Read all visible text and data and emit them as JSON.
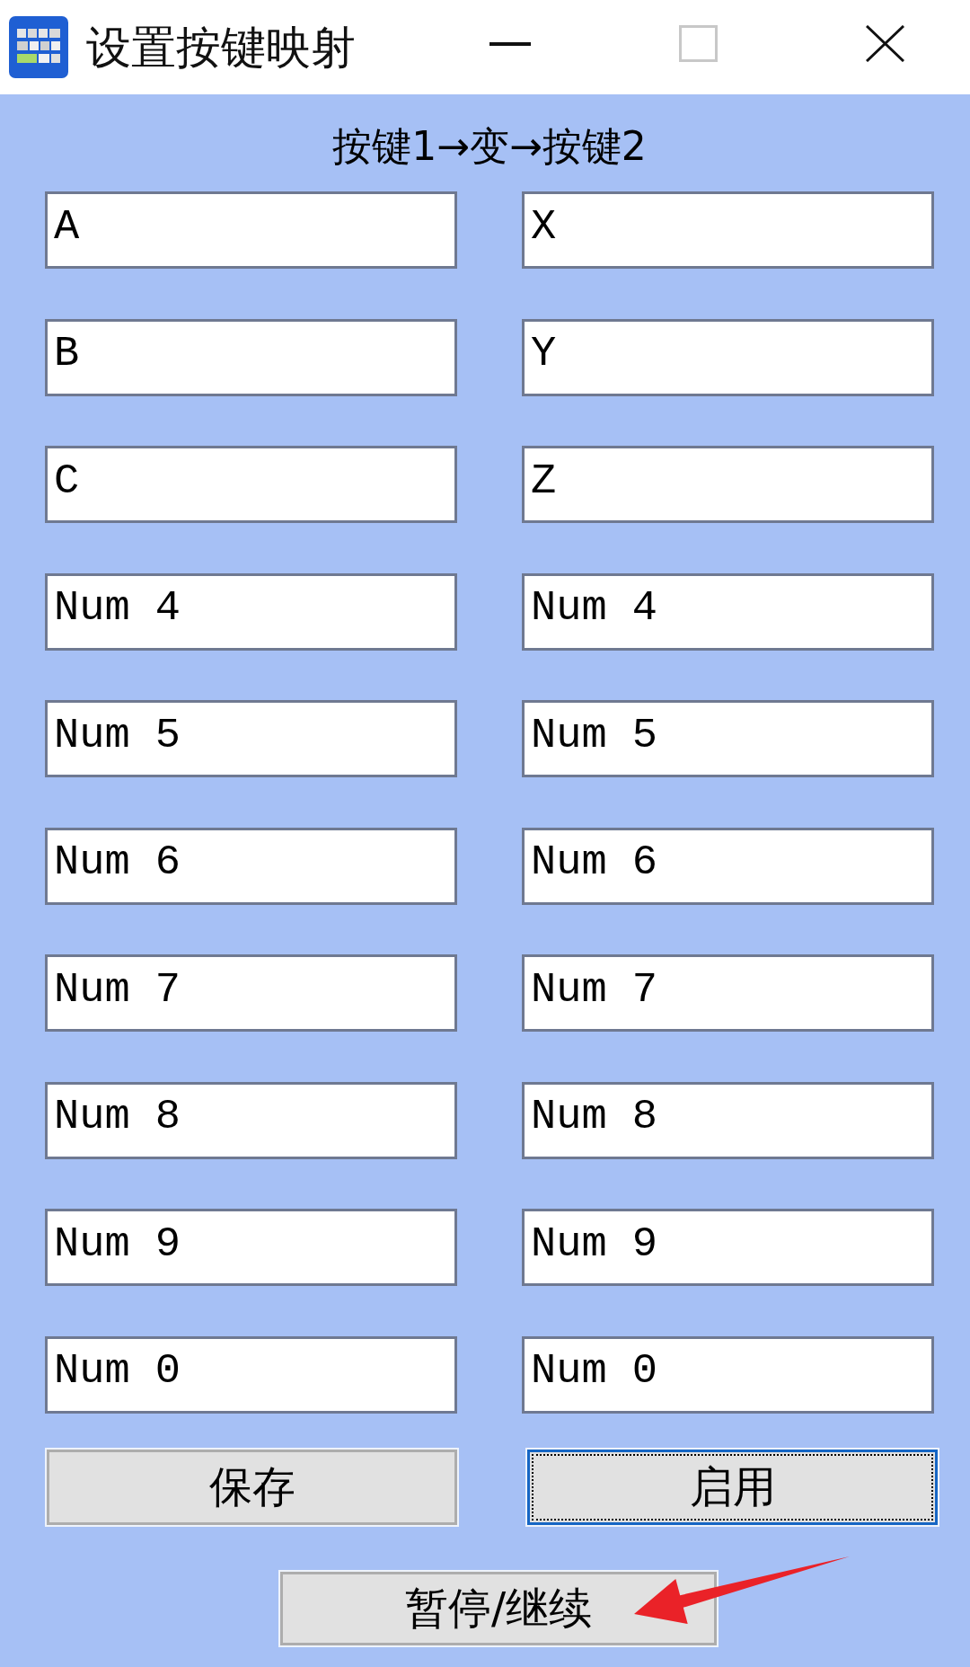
{
  "window": {
    "title": "设置按键映射",
    "controls": [
      {
        "kind": "minimize",
        "disabled": false
      },
      {
        "kind": "maximize",
        "disabled": true
      },
      {
        "kind": "close",
        "disabled": false
      }
    ]
  },
  "header": "按键1→变→按键2",
  "mappings": [
    {
      "from": "A",
      "to": "X"
    },
    {
      "from": "B",
      "to": "Y"
    },
    {
      "from": "C",
      "to": "Z"
    },
    {
      "from": "Num 4",
      "to": "Num 4"
    },
    {
      "from": "Num 5",
      "to": "Num 5"
    },
    {
      "from": "Num 6",
      "to": "Num 6"
    },
    {
      "from": "Num 7",
      "to": "Num 7"
    },
    {
      "from": "Num 8",
      "to": "Num 8"
    },
    {
      "from": "Num 9",
      "to": "Num 9"
    },
    {
      "from": "Num 0",
      "to": "Num 0"
    }
  ],
  "buttons": [
    {
      "label": "保存",
      "focused": false
    },
    {
      "label": "启用",
      "focused": true
    }
  ],
  "pause_button": {
    "label": "暂停/继续",
    "focused": false
  }
}
